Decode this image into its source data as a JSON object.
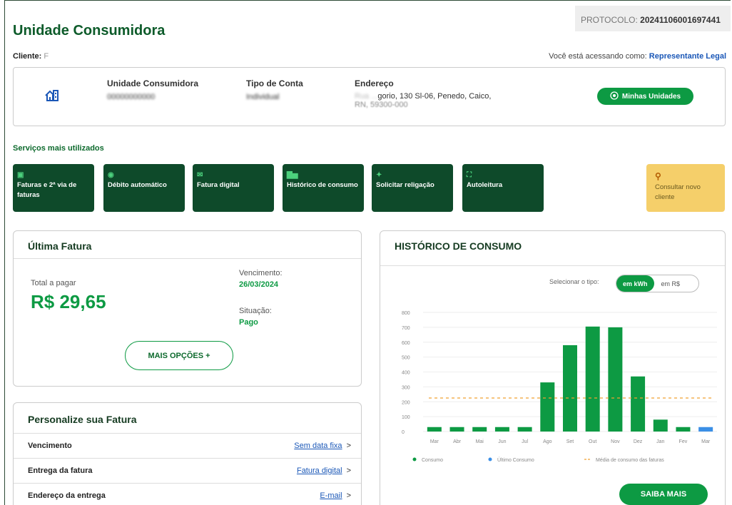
{
  "protocol": {
    "label": "PROTOCOLO:",
    "value": "20241106001697441"
  },
  "page_title": "Unidade Consumidora",
  "client": {
    "label": "Cliente:",
    "value": "F"
  },
  "access": {
    "text": "Você está acessando como:",
    "role": "Representante Legal"
  },
  "uc_card": {
    "col1_header": "Unidade Consumidora",
    "col1_value": "00000000000",
    "col2_header": "Tipo de Conta",
    "col2_value": "Individual",
    "col3_header": "Endereço",
    "address_line1_hidden": "Rua ...",
    "address_line1": "gorio, 130 Sl-06, Penedo, Caico,",
    "address_line2": "RN, 59300-000",
    "button_label": "Minhas Unidades"
  },
  "services": {
    "title": "Serviços mais utilizados",
    "items": [
      {
        "label": "Faturas e 2ª via de faturas",
        "icon": "document-icon"
      },
      {
        "label": "Débito automático",
        "icon": "coin-icon"
      },
      {
        "label": "Fatura digital",
        "icon": "mail-icon"
      },
      {
        "label": "Histórico de consumo",
        "icon": "bar-chart-icon"
      },
      {
        "label": "Solicitar religação",
        "icon": "lightning-icon"
      },
      {
        "label": "Autoleitura",
        "icon": "scan-icon"
      }
    ],
    "new_client": {
      "label": "Consultar novo cliente",
      "icon": "search-icon"
    }
  },
  "ultima_fatura": {
    "title": "Última Fatura",
    "total_label": "Total a pagar",
    "total_value": "R$ 29,65",
    "vencimento_label": "Vencimento:",
    "vencimento_value": "26/03/2024",
    "situacao_label": "Situação:",
    "situacao_value": "Pago",
    "button": "MAIS OPÇÕES +"
  },
  "personalize": {
    "title": "Personalize sua Fatura",
    "rows": [
      {
        "label": "Vencimento",
        "value": "Sem data fixa"
      },
      {
        "label": "Entrega da fatura",
        "value": "Fatura digital"
      },
      {
        "label": "Endereço da entrega",
        "value": "E-mail"
      }
    ],
    "arrow": ">"
  },
  "historico": {
    "title": "HISTÓRICO DE CONSUMO",
    "select_label": "Selecionar o tipo:",
    "toggle_on": "em kWh",
    "toggle_off": "em R$",
    "button": "SAIBA MAIS"
  },
  "chart_data": {
    "type": "bar",
    "categories": [
      "Mar",
      "Abr",
      "Mai",
      "Jun",
      "Jul",
      "Ago",
      "Set",
      "Out",
      "Nov",
      "Dez",
      "Jan",
      "Fev",
      "Mar"
    ],
    "series": [
      {
        "name": "Consumo",
        "values": [
          30,
          30,
          30,
          30,
          30,
          330,
          580,
          705,
          700,
          370,
          80,
          30,
          null
        ],
        "color": "#0d9a43"
      },
      {
        "name": "Último Consumo",
        "values": [
          null,
          null,
          null,
          null,
          null,
          null,
          null,
          null,
          null,
          null,
          null,
          null,
          30
        ],
        "color": "#3b8fe6"
      }
    ],
    "average_line": {
      "name": "Média de consumo das faturas",
      "value": 225,
      "color": "#f0a030"
    },
    "yticks": [
      0,
      100,
      200,
      300,
      400,
      500,
      600,
      700,
      800
    ],
    "ylim": [
      0,
      800
    ],
    "grid": true,
    "legend_position": "bottom"
  }
}
